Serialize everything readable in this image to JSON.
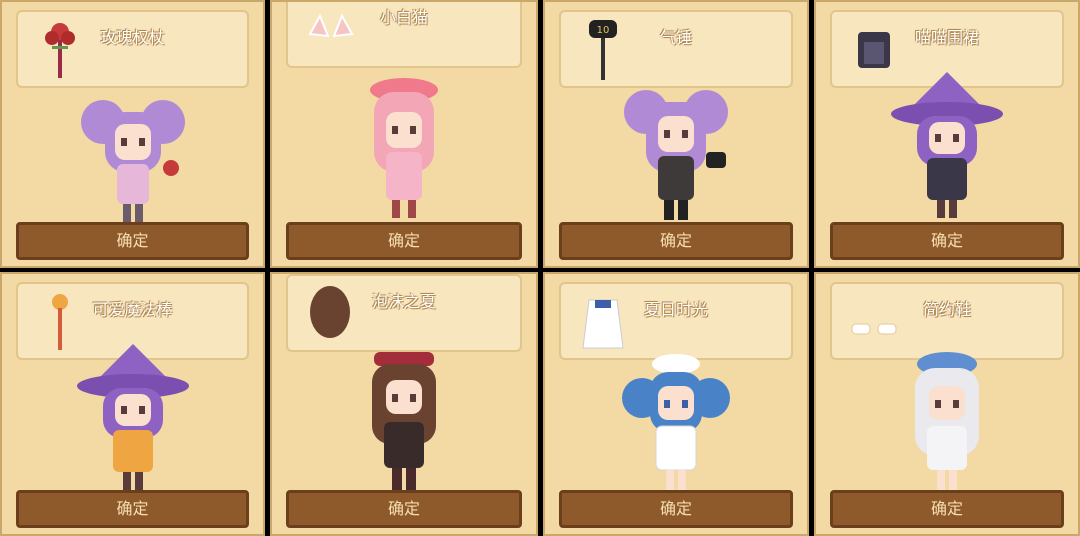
{
  "cards": [
    {
      "title": "玫瑰权杖",
      "button": "确定",
      "icon": "rose-scepter-icon",
      "hair": "#b18ad6",
      "dress": "#e7b7d9"
    },
    {
      "title": "小白猫",
      "button": "确定",
      "icon": "cat-ears-icon",
      "hair": "#f3a6b6",
      "dress": "#f5b4c7"
    },
    {
      "title": "气锤",
      "button": "确定",
      "icon": "hammer-icon",
      "hair": "#b18ad6",
      "dress": "#3e3a3a"
    },
    {
      "title": "喵喵围裙",
      "button": "确定",
      "icon": "apron-icon",
      "hair": "#8e62c2",
      "dress": "#3a3748"
    },
    {
      "title": "可爱魔法棒",
      "button": "确定",
      "icon": "magic-wand-icon",
      "hair": "#8e62c2",
      "dress": "#f0a543"
    },
    {
      "title": "泡沫之夏",
      "button": "确定",
      "icon": "wig-icon",
      "hair": "#6a4330",
      "dress": "#3a2b2b"
    },
    {
      "title": "夏日时光",
      "button": "确定",
      "icon": "sailor-dress-icon",
      "hair": "#4a82c8",
      "dress": "#ffffff"
    },
    {
      "title": "简约鞋",
      "button": "确定",
      "icon": "shoes-icon",
      "hair": "#e9e9ee",
      "dress": "#f4f4f6"
    }
  ]
}
